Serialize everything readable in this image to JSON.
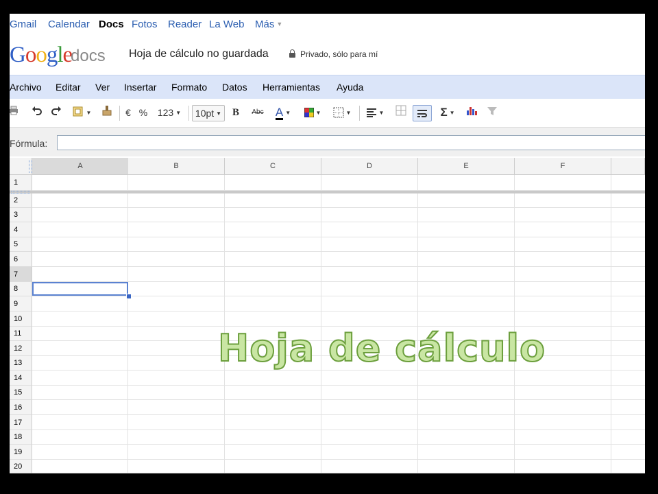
{
  "topnav": {
    "items": [
      "Gmail",
      "Calendar",
      "Docs",
      "Fotos",
      "Reader",
      "La Web",
      "Más"
    ],
    "active": "Docs"
  },
  "header": {
    "logo_letters": [
      "G",
      "o",
      "o",
      "g",
      "l",
      "e"
    ],
    "logo_suffix": "docs",
    "doc_title": "Hoja de cálculo no guardada",
    "privacy": "Privado, sólo para mí"
  },
  "menubar": {
    "items": [
      "Archivo",
      "Editar",
      "Ver",
      "Insertar",
      "Formato",
      "Datos",
      "Herramientas",
      "Ayuda"
    ]
  },
  "toolbar": {
    "currency": "€",
    "percent": "%",
    "number_format": "123",
    "font_size": "10pt",
    "bold": "B",
    "strikethrough": "Abc",
    "text_color": "A",
    "sum": "Σ",
    "icons": [
      "print-icon",
      "undo-icon",
      "redo-icon",
      "paint-format-icon",
      "clear-format-icon",
      "text-color-icon",
      "fill-color-icon",
      "borders-icon",
      "align-icon",
      "merge-icon",
      "wrap-icon",
      "sum-icon",
      "chart-icon",
      "filter-icon"
    ]
  },
  "formulabar": {
    "label": "Fórmula:",
    "value": ""
  },
  "grid": {
    "columns": [
      "A",
      "B",
      "C",
      "D",
      "E",
      "F"
    ],
    "rows": [
      "1",
      "2",
      "3",
      "4",
      "5",
      "6",
      "7",
      "8",
      "9",
      "10",
      "11",
      "12",
      "13",
      "14",
      "15",
      "16",
      "17",
      "18",
      "19",
      "20"
    ],
    "selected_cell": "A7"
  },
  "overlay": {
    "title": "Hoja de cálculo"
  },
  "colors": {
    "menubar_bg": "#dbe5f9",
    "link": "#2a5db0",
    "selection": "#5b82d1",
    "overlay_fill": "#c9e6a3",
    "overlay_stroke": "#6c9f3d"
  }
}
